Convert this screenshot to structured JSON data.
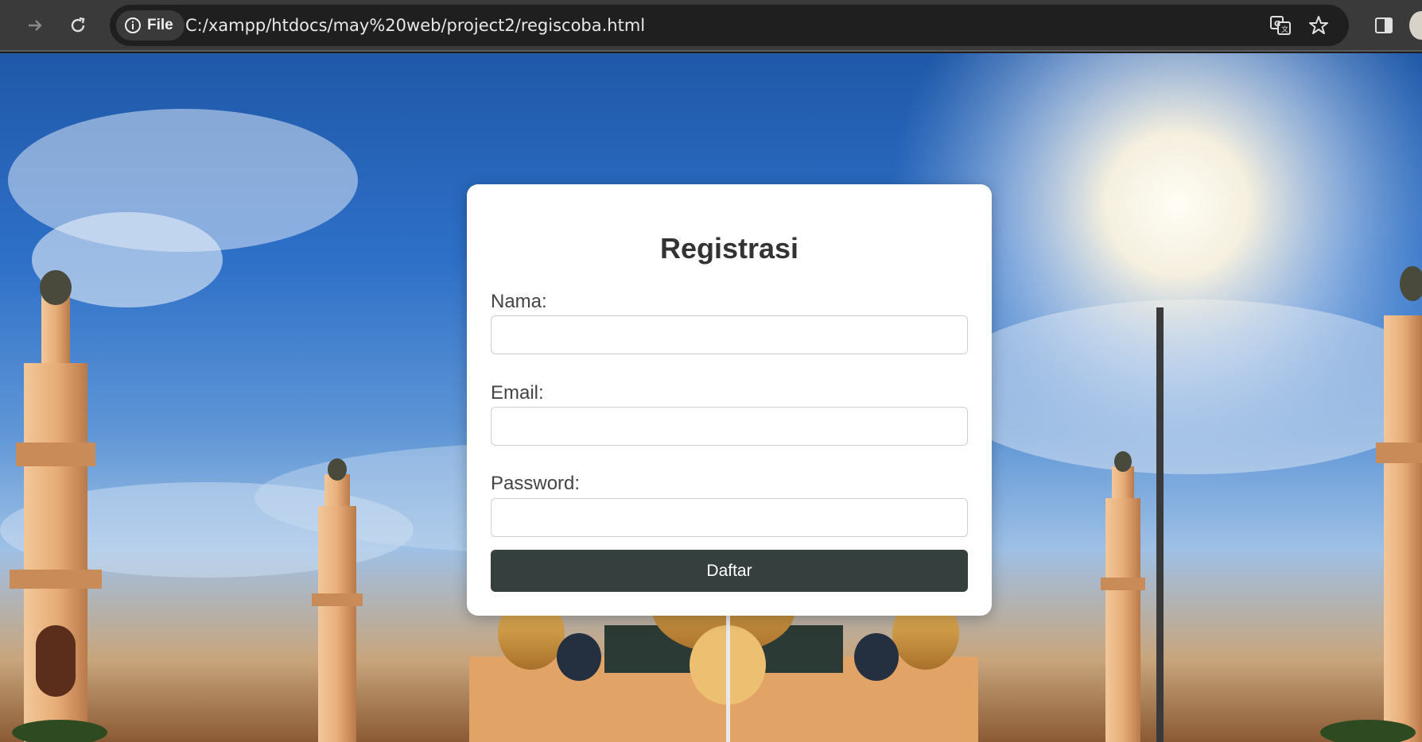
{
  "browser": {
    "forward_icon": "arrow-right-icon",
    "reload_icon": "reload-icon",
    "site_info_label": "File",
    "url": "C:/xampp/htdocs/may%20web/project2/regiscoba.html",
    "translate_icon": "translate-icon",
    "bookmark_icon": "star-icon",
    "side_panel_icon": "side-panel-icon"
  },
  "form": {
    "title": "Registrasi",
    "fields": [
      {
        "label": "Nama:",
        "value": "",
        "type": "text"
      },
      {
        "label": "Email:",
        "value": "",
        "type": "email"
      },
      {
        "label": "Password:",
        "value": "",
        "type": "password"
      }
    ],
    "submit_label": "Daftar"
  },
  "colors": {
    "button": "#343f3e",
    "card": "#ffffff",
    "toolbar": "#3a3a3a"
  }
}
